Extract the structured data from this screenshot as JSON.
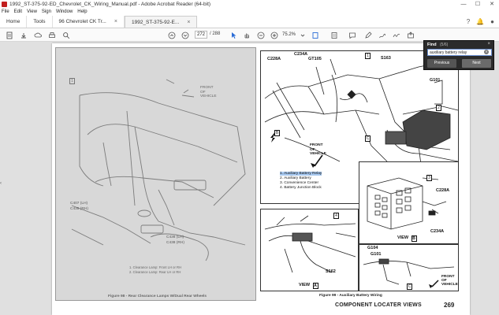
{
  "window": {
    "title": "1992_ST-375-92-ED_Chevrolet_CK_Wiring_Manual.pdf - Adobe Acrobat Reader (64-bit)",
    "minimize": "—",
    "maximize": "☐",
    "close": "✕"
  },
  "menu": [
    "File",
    "Edit",
    "View",
    "Sign",
    "Window",
    "Help"
  ],
  "tabs": {
    "home": "Home",
    "tools": "Tools",
    "doc1": "96 Chevrolet CK Tr...",
    "doc2": "1992_ST-375-92-E...",
    "close": "×"
  },
  "toolbar": {
    "page_current": "272",
    "page_total": "/ 288",
    "zoom": "75.2%"
  },
  "find": {
    "title": "Find",
    "count": "(5/6)",
    "query": "auxiliary battery relay",
    "previous": "Previous",
    "next": "Next",
    "close": "×"
  },
  "document": {
    "left_labels": {
      "box1": "1",
      "front": "FRONT\nOF\nVEHICLE",
      "c407": "C407 (LH)",
      "c435": "C435 (RH)",
      "c436": "C436 (LH)",
      "c438": "C438 (RH)",
      "legend1": "1.  Clearance Lamp: Front LH or RH",
      "legend2": "2.  Clearance Lamp: Rear LH or RH",
      "caption": "Figure 98 - Rear Clearance Lamps W/Dual Rear Wheels"
    },
    "right_labels": {
      "c228a": "C228A",
      "c234a": "C234A",
      "gt105": "GT105",
      "s163": "S163",
      "g101": "G101",
      "box1": "1",
      "box2": "2",
      "box3": "3",
      "box4": "4",
      "front": "FRONT\nOF\nVEHICLE",
      "legend1": "1.  Auxiliary Battery Relay",
      "legend2": "2.  Auxiliary Battery",
      "legend3": "3.  Convenience Center",
      "legend4": "4.  Battery Junction Block",
      "s162": "S162",
      "view_a": "VIEW",
      "view_a_letter": "A",
      "view_b": "VIEW",
      "view_b_letter": "B",
      "view_c_letter": "C",
      "g104": "G104",
      "g101b": "G101",
      "c228a_b": "C228A",
      "c234a_b": "C234A",
      "caption": "Figure 99 - Auxiliary Battery Wiring",
      "footer_title": "COMPONENT LOCATER VIEWS",
      "footer_num": "269"
    }
  }
}
